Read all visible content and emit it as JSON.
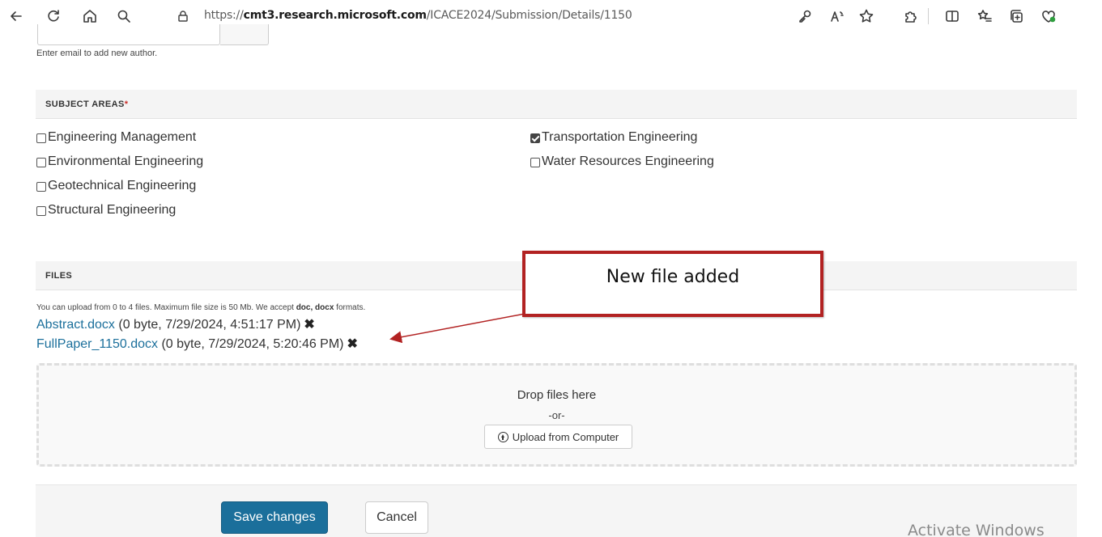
{
  "browser": {
    "url_prefix": "https://",
    "url_host": "cmt3.research.microsoft.com",
    "url_path": "/ICACE2024/Submission/Details/1150",
    "icons": [
      "back-icon",
      "refresh-icon",
      "home-icon",
      "search-icon",
      "site-info-icon",
      "key-icon",
      "read-aloud-icon",
      "favorite-icon",
      "extensions-icon",
      "split-screen-icon",
      "favorites-bar-icon",
      "collections-icon",
      "browser-essentials-icon"
    ]
  },
  "authors": {
    "hint": "Enter email to add new author."
  },
  "subject_areas": {
    "title": "SUBJECT AREAS",
    "required_mark": "*",
    "left": [
      {
        "label": "Engineering Management",
        "checked": false
      },
      {
        "label": "Environmental Engineering",
        "checked": false
      },
      {
        "label": "Geotechnical Engineering",
        "checked": false
      },
      {
        "label": "Structural Engineering",
        "checked": false
      }
    ],
    "right": [
      {
        "label": "Transportation Engineering",
        "checked": true
      },
      {
        "label": "Water Resources Engineering",
        "checked": false
      }
    ]
  },
  "files": {
    "title": "FILES",
    "note_prefix": "You can upload from 0 to 4 files. Maximum file size is 50 Mb. We accept ",
    "note_formats": "doc, docx",
    "note_suffix": " formats.",
    "items": [
      {
        "name": "Abstract.docx",
        "meta": " (0 byte, 7/29/2024, 4:51:17 PM)",
        "remove": "✖"
      },
      {
        "name": "FullPaper_1150.docx",
        "meta": " (0 byte, 7/29/2024, 5:20:46 PM)",
        "remove": "✖"
      }
    ],
    "drop_text": "Drop files here",
    "or_text": "-or-",
    "upload_label": "Upload from Computer"
  },
  "footer": {
    "save_label": "Save changes",
    "cancel_label": "Cancel"
  },
  "watermark": "Activate Windows",
  "annotation": {
    "text": "New file added",
    "color": "#b22222"
  },
  "colors": {
    "link": "#1b6f9b",
    "primary_button": "#1b6f9b",
    "required": "#c9302c"
  }
}
